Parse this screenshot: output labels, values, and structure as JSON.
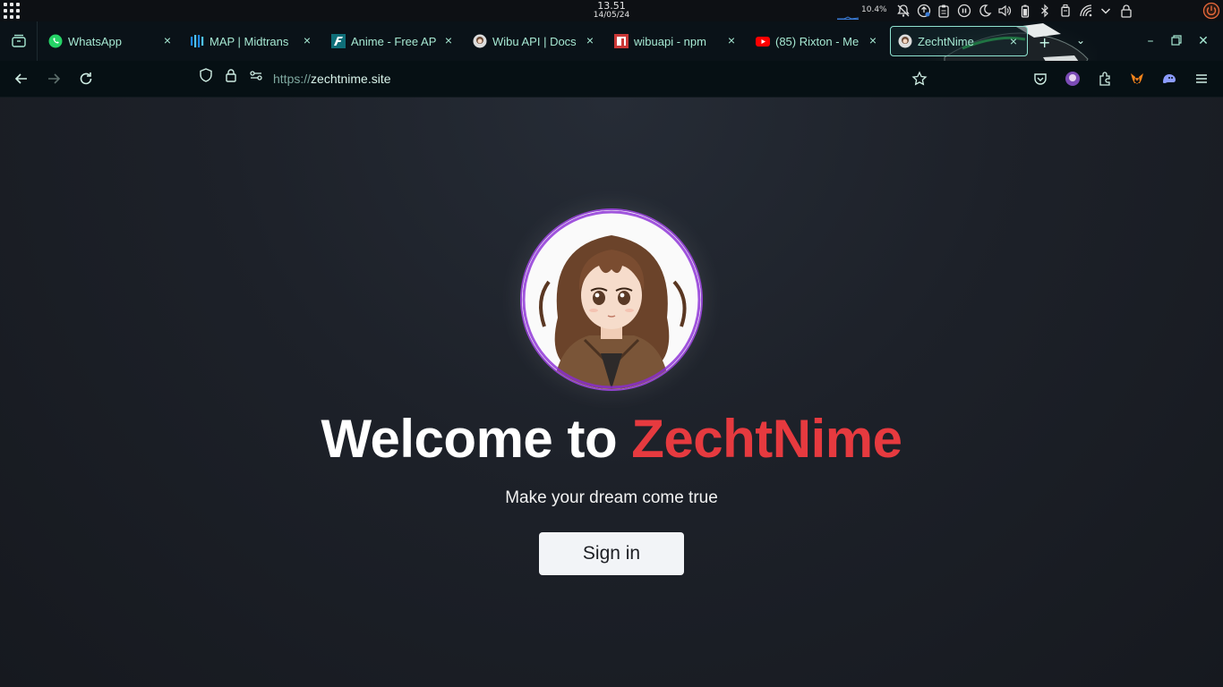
{
  "system_bar": {
    "time": "13.51",
    "date": "14/05/24",
    "cpu_usage": "10.4%",
    "tray_icons": [
      "notifications-muted-icon",
      "update-icon",
      "clipboard-icon",
      "media-icon",
      "night-light-icon",
      "volume-icon",
      "battery-icon",
      "bluetooth-icon",
      "device-icon",
      "wifi-icon",
      "expand-tray-icon",
      "lock-icon",
      "power-icon"
    ]
  },
  "tabs": [
    {
      "label": "WhatsApp",
      "icon": "whatsapp-icon",
      "color": "#25d366"
    },
    {
      "label": "MAP | Midtrans",
      "icon": "midtrans-icon",
      "color": "#1e88e5"
    },
    {
      "label": "Anime - Free AP",
      "icon": "anime-api-icon",
      "color": "#0f6e78"
    },
    {
      "label": "Wibu API | Docs",
      "icon": "wibu-avatar-icon",
      "color": "#cccccc"
    },
    {
      "label": "wibuapi - npm",
      "icon": "npm-icon",
      "color": "#cb3837"
    },
    {
      "label": "(85) Rixton - Me",
      "icon": "youtube-icon",
      "color": "#ff0000"
    },
    {
      "label": "ZechtNime",
      "icon": "zechtnime-icon",
      "color": "#cccccc",
      "active": true
    }
  ],
  "nav": {
    "url_scheme": "https://",
    "url_host": "zechtnime.site"
  },
  "page": {
    "welcome_prefix": "Welcome to ",
    "brand": "ZechtNime",
    "tagline": "Make your dream come true",
    "signin_label": "Sign in",
    "brand_color": "#e63a3f"
  }
}
